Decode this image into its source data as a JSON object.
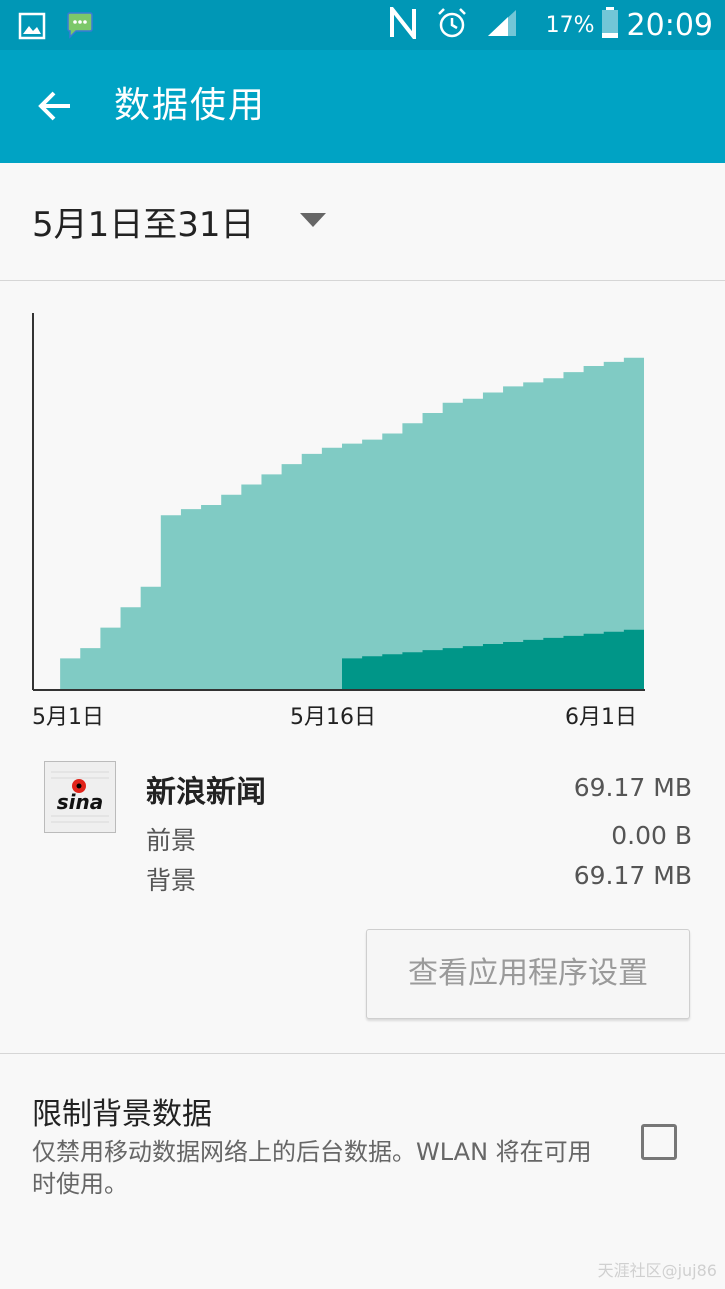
{
  "status_bar": {
    "left_icons": [
      "gallery-icon",
      "message-icon"
    ],
    "right_icons": [
      "nfc-icon",
      "alarm-icon",
      "signal-icon",
      "battery-icon"
    ],
    "battery_percent": "17%",
    "time": "20:09"
  },
  "app_bar": {
    "title": "数据使用",
    "back_icon": "arrow-left-icon"
  },
  "date_selector": {
    "range": "5月1日至31日"
  },
  "chart_data": {
    "type": "area",
    "x_labels": [
      "5月1日",
      "5月16日",
      "6月1日"
    ],
    "series": [
      {
        "color": "#80cbc4",
        "values": [
          0,
          15,
          20,
          30,
          40,
          50,
          85,
          88,
          90,
          95,
          100,
          105,
          110,
          115,
          118,
          120,
          122,
          125,
          130,
          135,
          140,
          142,
          145,
          148,
          150,
          152,
          155,
          158,
          160,
          162
        ]
      },
      {
        "color": "#009688",
        "values": [
          0,
          0,
          0,
          0,
          0,
          0,
          0,
          0,
          0,
          0,
          0,
          0,
          0,
          0,
          0,
          15,
          16,
          17,
          18,
          19,
          20,
          21,
          22,
          23,
          24,
          25,
          26,
          27,
          28,
          29
        ]
      }
    ],
    "ylim": [
      0,
      180
    ]
  },
  "app_usage": {
    "name": "新浪新闻",
    "icon_text": "sina",
    "total": "69.17 MB",
    "foreground_label": "前景",
    "foreground_value": "0.00 B",
    "background_label": "背景",
    "background_value": "69.17 MB"
  },
  "settings_button": {
    "label": "查看应用程序设置"
  },
  "restrict_background": {
    "title": "限制背景数据",
    "description": "仅禁用移动数据网络上的后台数据。WLAN 将在可用时使用。"
  },
  "watermark": "天涯社区@juj86"
}
